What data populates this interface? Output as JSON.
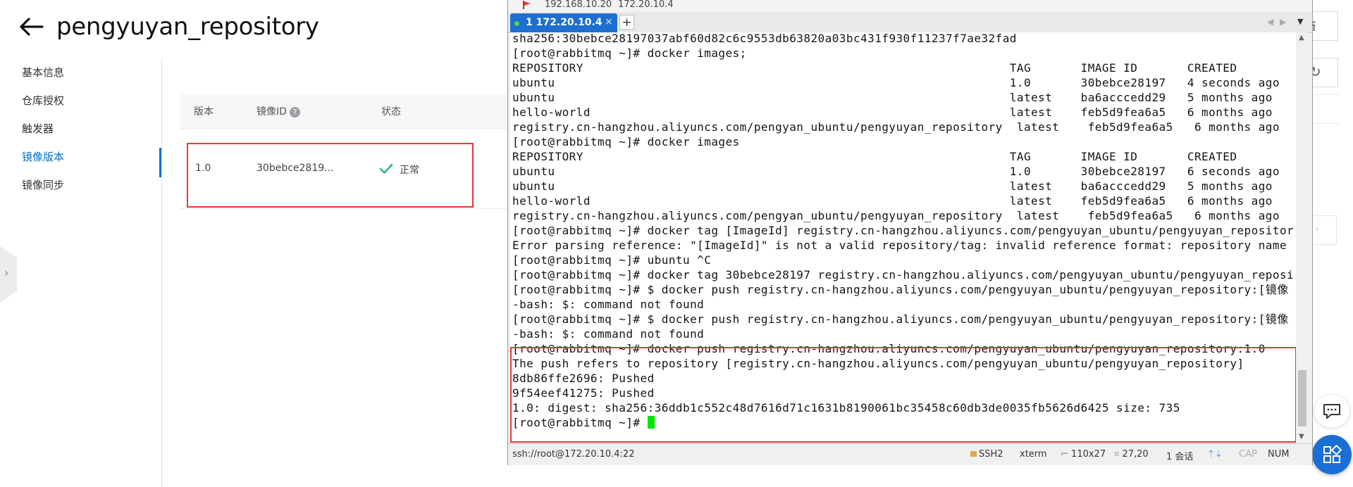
{
  "web": {
    "title": "pengyuyan_repository",
    "nav": [
      {
        "label": "基本信息"
      },
      {
        "label": "仓库授权"
      },
      {
        "label": "触发器"
      },
      {
        "label": "镜像版本"
      },
      {
        "label": "镜像同步"
      }
    ],
    "active_nav_index": 3,
    "table": {
      "headers": [
        "版本",
        "镜像ID",
        "状态"
      ],
      "rows": [
        {
          "version": "1.0",
          "image_id": "30bebce2819...",
          "status": "正常"
        }
      ]
    },
    "right_partial_label": "笞",
    "colors": {
      "accent": "#0070cc",
      "highlight": "#e53935",
      "success": "#2bb673"
    }
  },
  "terminal": {
    "hosts": [
      "192.168.10.20",
      "172.20.10.4"
    ],
    "tab": {
      "label": "1 172.20.10.4",
      "close": "×",
      "add": "+"
    },
    "lines": [
      "sha256:30bebce28197037abf60d82c6c9553db63820a03bc431f930f11237f7ae32fad",
      "[root@rabbitmq ~]# docker images;",
      "REPOSITORY                                                            TAG       IMAGE ID       CREATED",
      "ubuntu                                                                1.0       30bebce28197   4 seconds ago",
      "ubuntu                                                                latest    ba6acccedd29   5 months ago",
      "hello-world                                                           latest    feb5d9fea6a5   6 months ago",
      "registry.cn-hangzhou.aliyuncs.com/pengyan_ubuntu/pengyuyan_repository  latest    feb5d9fea6a5   6 months ago",
      "[root@rabbitmq ~]# docker images",
      "REPOSITORY                                                            TAG       IMAGE ID       CREATED",
      "ubuntu                                                                1.0       30bebce28197   6 seconds ago",
      "ubuntu                                                                latest    ba6acccedd29   5 months ago",
      "hello-world                                                           latest    feb5d9fea6a5   6 months ago",
      "registry.cn-hangzhou.aliyuncs.com/pengyan_ubuntu/pengyuyan_repository  latest    feb5d9fea6a5   6 months ago",
      "[root@rabbitmq ~]# docker tag [ImageId] registry.cn-hangzhou.aliyuncs.com/pengyuyan_ubuntu/pengyuyan_repositor",
      "Error parsing reference: \"[ImageId]\" is not a valid repository/tag: invalid reference format: repository name",
      "[root@rabbitmq ~]# ubuntu ^C",
      "[root@rabbitmq ~]# docker tag 30bebce28197 registry.cn-hangzhou.aliyuncs.com/pengyuyan_ubuntu/pengyuyan_reposi",
      "[root@rabbitmq ~]# $ docker push registry.cn-hangzhou.aliyuncs.com/pengyuyan_ubuntu/pengyuyan_repository:[镜像",
      "-bash: $: command not found",
      "[root@rabbitmq ~]# $ docker push registry.cn-hangzhou.aliyuncs.com/pengyuyan_ubuntu/pengyuyan_repository:[镜像",
      "-bash: $: command not found",
      "[root@rabbitmq ~]# docker push registry.cn-hangzhou.aliyuncs.com/pengyuyan_ubuntu/pengyuyan_repository:1.0",
      "The push refers to repository [registry.cn-hangzhou.aliyuncs.com/pengyuyan_ubuntu/pengyuyan_repository]",
      "8db86ffe2696: Pushed",
      "9f54eef41275: Pushed",
      "1.0: digest: sha256:36ddb1c552c48d7616d71c1631b8190061bc35458c60db3de0035fb5626d6425 size: 735",
      "[root@rabbitmq ~]# "
    ],
    "status_bar": {
      "connection": "ssh://root@172.20.10.4:22",
      "protocol": "SSH2",
      "term": "xterm",
      "size": "110x27",
      "cursor_pos": "27,20",
      "sessions": "1 会话",
      "cap": "CAP",
      "num": "NUM"
    },
    "colors": {
      "tab": "#1e6fd0",
      "cursor": "#00e600",
      "highlight": "#e53935"
    }
  }
}
